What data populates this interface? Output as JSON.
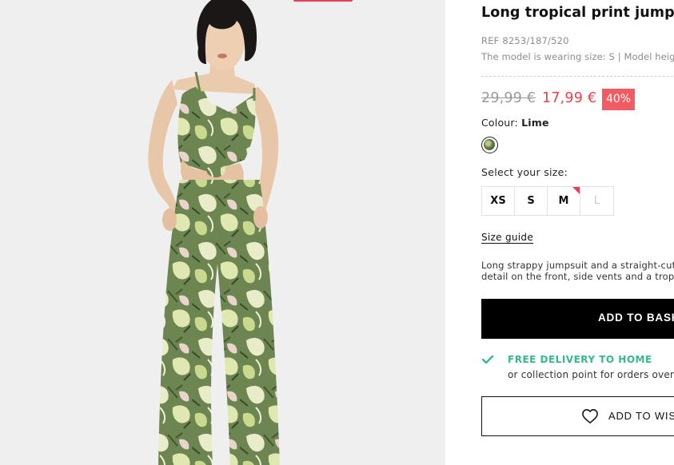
{
  "product": {
    "title": "Long tropical print jumpsuit",
    "ref": "REF 8253/187/520",
    "model_info": "The model is wearing size: S | Model height",
    "old_price": "29,99 €",
    "new_price": "17,99 €",
    "discount": "40%",
    "colour_label": "Colour: ",
    "colour_value": "Lime",
    "size_label": "Select your size:",
    "sizes": [
      {
        "label": "XS",
        "available": true
      },
      {
        "label": "S",
        "available": true
      },
      {
        "label": "M",
        "available": true,
        "low_stock": true
      },
      {
        "label": "L",
        "available": false
      }
    ],
    "size_guide": "Size guide",
    "description_line1": "Long strappy jumpsuit and a straight-cut r",
    "description_line2": "detail on the front, side vents and a tropic",
    "add_to_basket": "ADD TO BASK",
    "delivery_title": "FREE DELIVERY TO HOME",
    "delivery_subtitle": "or collection point for orders over",
    "wishlist": "ADD TO WISH"
  },
  "icons": {
    "delivery": "check-icon",
    "wishlist": "heart-icon"
  },
  "colors": {
    "sale_price": "#e8414e",
    "discount_badge": "#f05c62",
    "delivery_accent": "#35b98b",
    "low_stock_marker": "#e5415e",
    "swatch": "#5e7a45"
  }
}
